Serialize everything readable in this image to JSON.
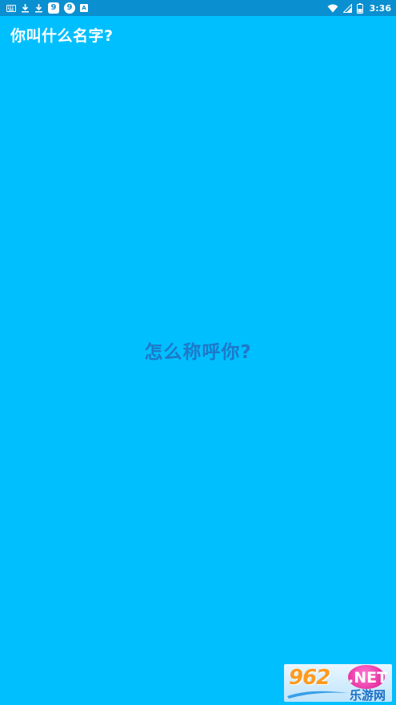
{
  "status_bar": {
    "left_icons": [
      "keyboard-icon",
      "download-icon",
      "download-icon",
      "app-9-icon",
      "app-9-icon",
      "a-icon"
    ],
    "badge_9": "9",
    "badge_a": "A",
    "battery_level": "3",
    "time": "3:36"
  },
  "app_bar": {
    "title": "你叫什么名字?"
  },
  "main": {
    "prompt": "怎么称呼你?"
  },
  "watermark": {
    "number": "962",
    "suffix": ".NET",
    "name": "乐游网"
  },
  "colors": {
    "background": "#00bfff",
    "status_bar": "#0a8fd0",
    "prompt_text": "#1f78c8"
  }
}
